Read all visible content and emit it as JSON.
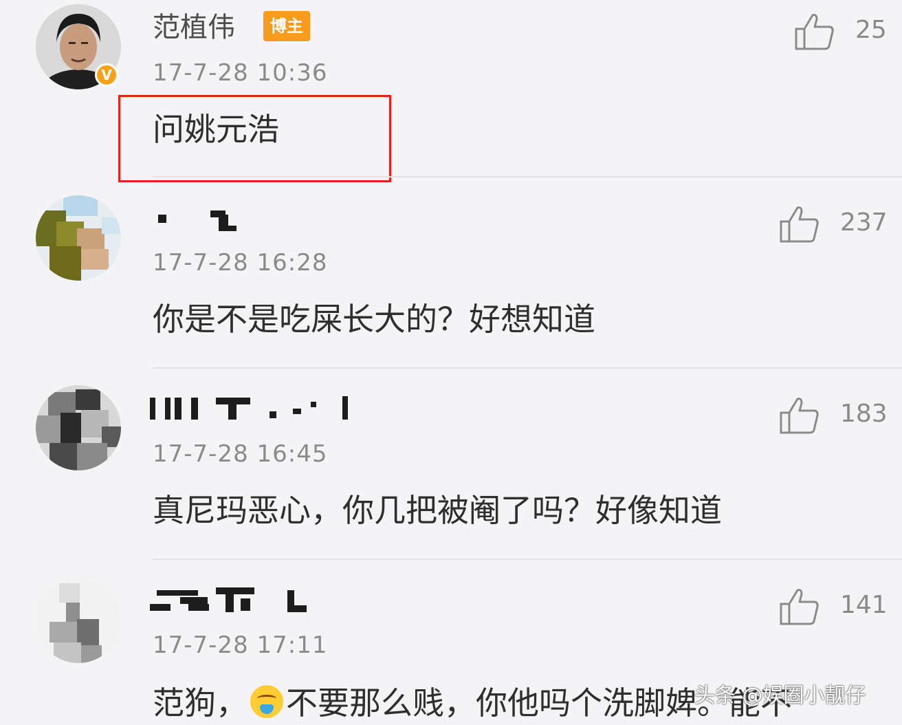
{
  "comments": [
    {
      "username": "范植伟",
      "badge": "博主",
      "verified_mark": "V",
      "timestamp": "17-7-28 10:36",
      "text": "问姚元浩",
      "likes": "25"
    },
    {
      "username": "",
      "timestamp": "17-7-28 16:28",
      "text": "你是不是吃屎长大的？好想知道",
      "likes": "237"
    },
    {
      "username": "",
      "timestamp": "17-7-28 16:45",
      "text": "真尼玛恶心，你几把被阉了吗？好像知道",
      "likes": "183"
    },
    {
      "username": "",
      "timestamp": "17-7-28 17:11",
      "text_before_emoji": "范狗，",
      "text_after_emoji": "不要那么贱，你他吗个洗脚婢。能不",
      "likes": "141"
    }
  ],
  "watermark": "头条 @娱圈小靓仔",
  "colors": {
    "background": "#f4f4f6",
    "badge_orange": "#f79b1d",
    "highlight_red": "#e5211a"
  },
  "icons": {
    "like": "thumbs-up-icon",
    "emoji": "vomiting-face-icon"
  }
}
